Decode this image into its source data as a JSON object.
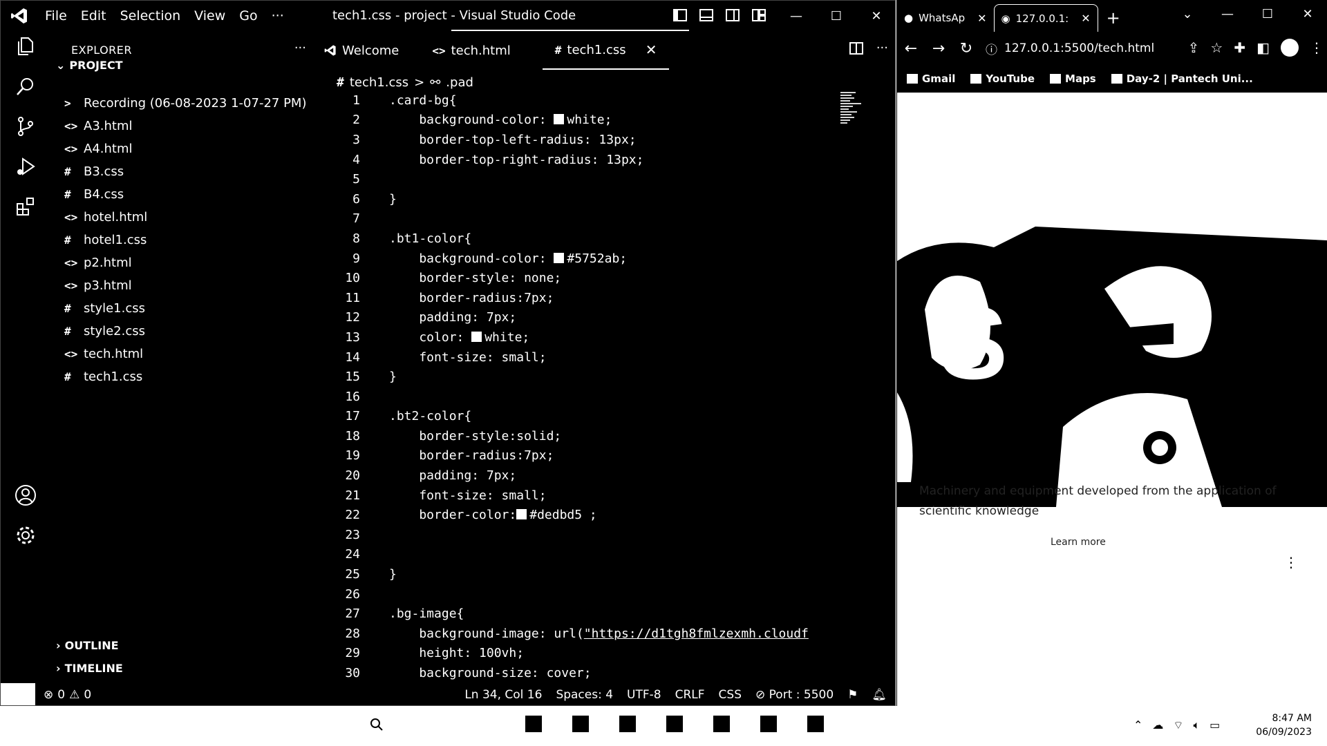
{
  "vscode": {
    "menu": [
      "File",
      "Edit",
      "Selection",
      "View",
      "Go",
      "···"
    ],
    "window_title": "tech1.css - project - Visual Studio Code",
    "explorer": {
      "header": "EXPLORER",
      "more": "···",
      "section_project": "PROJECT",
      "files": [
        {
          "icon": ">",
          "name": "Recording (06-08-2023 1-07-27 PM)"
        },
        {
          "icon": "<>",
          "name": "A3.html"
        },
        {
          "icon": "<>",
          "name": "A4.html"
        },
        {
          "icon": "#",
          "name": "B3.css"
        },
        {
          "icon": "#",
          "name": "B4.css"
        },
        {
          "icon": "<>",
          "name": "hotel.html"
        },
        {
          "icon": "#",
          "name": "hotel1.css"
        },
        {
          "icon": "<>",
          "name": "p2.html"
        },
        {
          "icon": "<>",
          "name": "p3.html"
        },
        {
          "icon": "#",
          "name": "style1.css"
        },
        {
          "icon": "#",
          "name": "style2.css"
        },
        {
          "icon": "<>",
          "name": "tech.html"
        },
        {
          "icon": "#",
          "name": "tech1.css"
        }
      ],
      "section_outline": "OUTLINE",
      "section_timeline": "TIMELINE"
    },
    "tabs": [
      {
        "icon": "vscode-icon",
        "label": "Welcome"
      },
      {
        "icon": "<>",
        "label": "tech.html"
      },
      {
        "icon": "#",
        "label": "tech1.css",
        "close": "✕"
      }
    ],
    "breadcrumb": {
      "file_icon": "#",
      "file": "tech1.css",
      "sep": ">",
      "symbol": ".pad"
    },
    "code_lines": [
      {
        "n": "1",
        "text": ".card-bg{"
      },
      {
        "n": "2",
        "text": "    background-color: ",
        "swatch": true,
        "after": "white;"
      },
      {
        "n": "3",
        "text": "    border-top-left-radius: 13px;"
      },
      {
        "n": "4",
        "text": "    border-top-right-radius: 13px;"
      },
      {
        "n": "5",
        "text": ""
      },
      {
        "n": "6",
        "text": "}"
      },
      {
        "n": "7",
        "text": ""
      },
      {
        "n": "8",
        "text": ".bt1-color{"
      },
      {
        "n": "9",
        "text": "    background-color: ",
        "swatch": true,
        "after": "#5752ab;"
      },
      {
        "n": "10",
        "text": "    border-style: none;"
      },
      {
        "n": "11",
        "text": "    border-radius:7px;"
      },
      {
        "n": "12",
        "text": "    padding: 7px;"
      },
      {
        "n": "13",
        "text": "    color: ",
        "swatch": true,
        "after": "white;"
      },
      {
        "n": "14",
        "text": "    font-size: small;"
      },
      {
        "n": "15",
        "text": "}"
      },
      {
        "n": "16",
        "text": ""
      },
      {
        "n": "17",
        "text": ".bt2-color{"
      },
      {
        "n": "18",
        "text": "    border-style:solid;"
      },
      {
        "n": "19",
        "text": "    border-radius:7px;"
      },
      {
        "n": "20",
        "text": "    padding: 7px;"
      },
      {
        "n": "21",
        "text": "    font-size: small;"
      },
      {
        "n": "22",
        "text": "    border-color:",
        "swatch": true,
        "after": "#dedbd5 ;"
      },
      {
        "n": "23",
        "text": ""
      },
      {
        "n": "24",
        "text": ""
      },
      {
        "n": "25",
        "text": "}"
      },
      {
        "n": "26",
        "text": ""
      },
      {
        "n": "27",
        "text": ".bg-image{"
      },
      {
        "n": "28",
        "text": "    background-image: url(",
        "url": "\"https://d1tgh8fmlzexmh.cloudf"
      },
      {
        "n": "29",
        "text": "    height: 100vh;"
      },
      {
        "n": "30",
        "text": "    background-size: cover;"
      }
    ],
    "status": {
      "errors": "0",
      "warnings": "0",
      "position": "Ln 34, Col 16",
      "spaces": "Spaces: 4",
      "encoding": "UTF-8",
      "eol": "CRLF",
      "language": "CSS",
      "port": "Port : 5500"
    }
  },
  "browser": {
    "tabs": [
      {
        "label": "WhatsAp",
        "icon": "whatsapp-icon"
      },
      {
        "label": "127.0.0.1:",
        "icon": "globe-icon"
      }
    ],
    "new_tab": "+",
    "url": "127.0.0.1:5500/tech.html",
    "bookmarks": [
      "Gmail",
      "YouTube",
      "Maps",
      "Day-2 | Pantech Uni..."
    ],
    "page": {
      "description": "Machinery and equipment developed from the application of scientific knowledge",
      "learn_more": "Learn more",
      "dots": "⋮"
    }
  },
  "taskbar": {
    "time": "8:47 AM",
    "date": "06/09/2023"
  }
}
